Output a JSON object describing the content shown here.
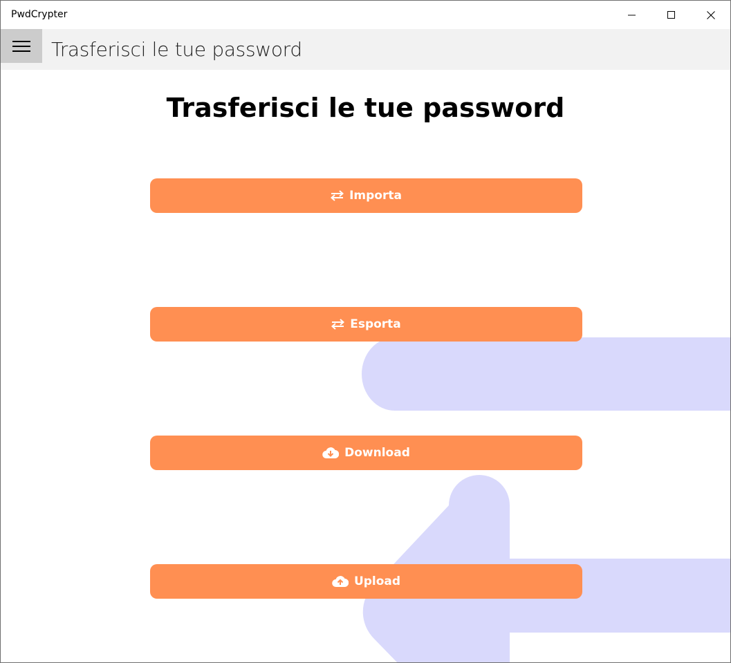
{
  "window": {
    "title": "PwdCrypter",
    "controls": {
      "minimize_icon": "minimize-icon",
      "maximize_icon": "maximize-icon",
      "close_icon": "close-icon"
    }
  },
  "header": {
    "menu_icon": "hamburger-icon",
    "title": "Trasferisci le tue password"
  },
  "main": {
    "title": "Trasferisci le tue password",
    "buttons": [
      {
        "label": "Importa",
        "icon": "exchange-icon"
      },
      {
        "label": "Esporta",
        "icon": "exchange-icon"
      },
      {
        "label": "Download",
        "icon": "cloud-download-icon"
      },
      {
        "label": "Upload",
        "icon": "cloud-upload-icon"
      }
    ]
  },
  "colors": {
    "accent": "#ff8f52",
    "background_shape": "#d9d9fc",
    "header_bg": "#f2f2f2",
    "hamburger_bg": "#cccccc"
  }
}
